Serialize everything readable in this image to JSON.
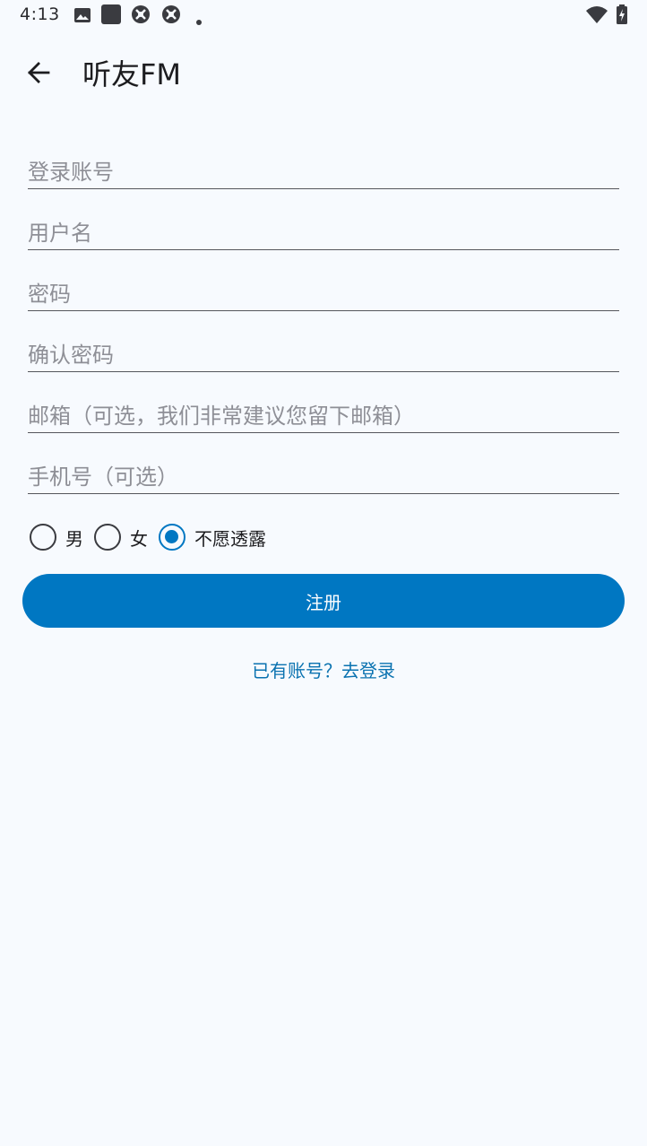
{
  "status_bar": {
    "time": "4:13",
    "icons": [
      "image-icon",
      "app-square-icon",
      "sync-icon",
      "sync-icon",
      "dot-icon",
      "wifi-icon",
      "battery-icon"
    ]
  },
  "app_bar": {
    "title": "听友FM",
    "back_icon": "arrow-left-icon"
  },
  "form": {
    "fields": [
      {
        "name": "account",
        "placeholder": "登录账号",
        "value": ""
      },
      {
        "name": "username",
        "placeholder": "用户名",
        "value": ""
      },
      {
        "name": "password",
        "placeholder": "密码",
        "value": ""
      },
      {
        "name": "confirm_password",
        "placeholder": "确认密码",
        "value": ""
      },
      {
        "name": "email",
        "placeholder": "邮箱（可选，我们非常建议您留下邮箱）",
        "value": ""
      },
      {
        "name": "phone",
        "placeholder": "手机号（可选）",
        "value": ""
      }
    ],
    "gender": {
      "options": [
        "男",
        "女",
        "不愿透露"
      ],
      "selected": "不愿透露"
    },
    "register_label": "注册",
    "login_link": "已有账号？去登录"
  },
  "colors": {
    "accent": "#0077c2",
    "link": "#0a72b0",
    "background": "#f7fafe",
    "placeholder": "#8e8f96"
  }
}
